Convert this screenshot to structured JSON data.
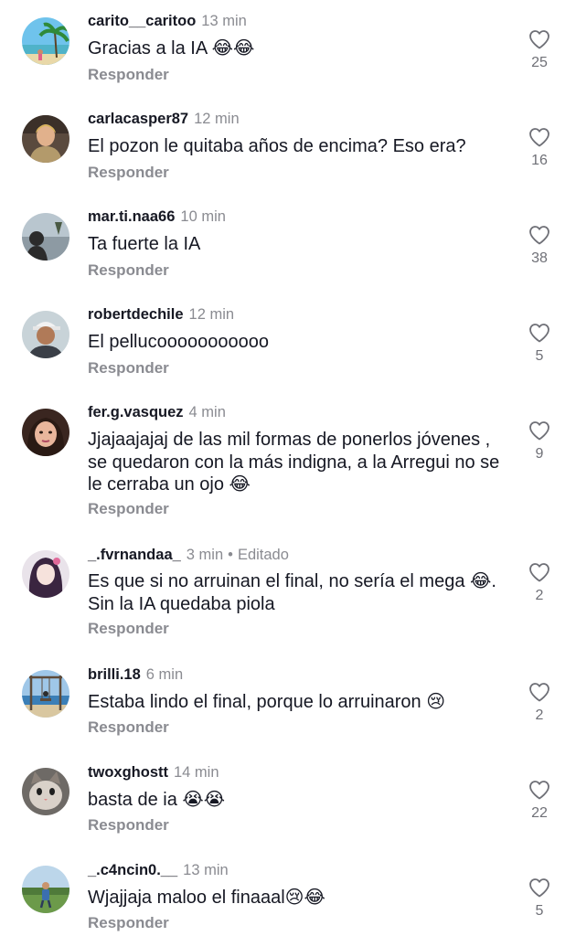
{
  "comments": [
    {
      "username": "carito__caritoo",
      "time": "13 min",
      "text": "Gracias a la IA 😂😂",
      "reply": "Responder",
      "likes": "25",
      "avatar_icon": "beach-palm-photo"
    },
    {
      "username": "carlacasper87",
      "time": "12 min",
      "text": "El pozon le quitaba años de encima? Eso era?",
      "reply": "Responder",
      "likes": "16",
      "avatar_icon": "person-photo"
    },
    {
      "username": "mar.ti.naa66",
      "time": "10 min",
      "text": "Ta fuerte la IA",
      "reply": "Responder",
      "likes": "38",
      "avatar_icon": "silhouette-sky-photo"
    },
    {
      "username": "robertdechile",
      "time": "12 min",
      "text": "El pellucooooooooooo",
      "reply": "Responder",
      "likes": "5",
      "avatar_icon": "man-cap-photo"
    },
    {
      "username": "fer.g.vasquez",
      "time": "4 min",
      "text": "Jjajaajajaj de las mil formas de ponerlos jóvenes , se quedaron con la más indigna, a la Arregui no se le cerraba un ojo 😂",
      "reply": "Responder",
      "likes": "9",
      "avatar_icon": "woman-selfie-photo"
    },
    {
      "username": "_.fvrnandaa_",
      "time": "3 min",
      "edited": "Editado",
      "text": "Es que si no arruinan el final, no sería el mega 😂. Sin la IA quedaba piola",
      "reply": "Responder",
      "likes": "2",
      "avatar_icon": "anime-girl-photo"
    },
    {
      "username": "brilli.18",
      "time": "6 min",
      "text": "Estaba lindo el final, porque lo arruinaron 😢",
      "reply": "Responder",
      "likes": "2",
      "avatar_icon": "swing-sea-photo"
    },
    {
      "username": "twoxghostt",
      "time": "14 min",
      "text": "basta de ia 😭😭",
      "reply": "Responder",
      "likes": "22",
      "avatar_icon": "cat-photo"
    },
    {
      "username": "_.c4ncin0.__",
      "time": "13 min",
      "text": "Wjajjaja maloo el finaaal😢😂",
      "reply": "Responder",
      "likes": "5",
      "avatar_icon": "field-child-photo"
    }
  ],
  "icons": {
    "like": "heart-outline-icon"
  },
  "colors": {
    "text": "#161823",
    "muted": "#8a8b91",
    "background": "#ffffff"
  }
}
